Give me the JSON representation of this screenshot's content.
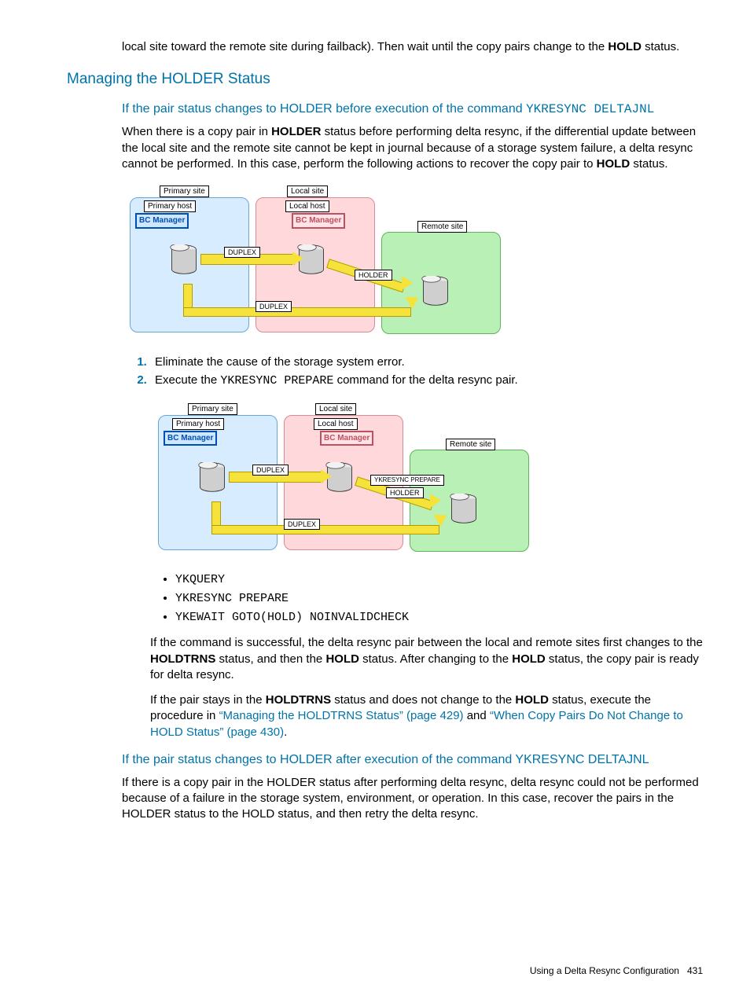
{
  "intro": {
    "p1a": "local site toward the remote site during failback). Then wait until the copy pairs change to the ",
    "p1b": "HOLD",
    "p1c": " status."
  },
  "h2": "Managing the HOLDER Status",
  "sec1": {
    "h3a": "If the pair status changes to HOLDER before execution of the command ",
    "h3b": "YKRESYNC DELTAJNL",
    "p1a": "When there is a copy pair in ",
    "p1b": "HOLDER",
    "p1c": " status before performing delta resync, if the differential update between the local site and the remote site cannot be kept in journal because of a storage system failure, a delta resync cannot be performed. In this case, perform the following actions to recover the copy pair to ",
    "p1d": "HOLD",
    "p1e": " status."
  },
  "diagram1": {
    "primary_site": "Primary site",
    "primary_host": "Primary host",
    "bc": "BC Manager",
    "local_site": "Local site",
    "local_host": "Local host",
    "remote_site": "Remote site",
    "duplex": "DUPLEX",
    "holder": "HOLDER"
  },
  "steps": {
    "s1": "Eliminate the cause of the storage system error.",
    "s2a": "Execute the ",
    "s2b": "YKRESYNC PREPARE",
    "s2c": " command for the delta resync pair."
  },
  "diagram2": {
    "ykresync_prepare": "YKRESYNC PREPARE"
  },
  "cmds": {
    "c1": "YKQUERY",
    "c2": "YKRESYNC PREPARE",
    "c3": "YKEWAIT GOTO(HOLD) NOINVALIDCHECK"
  },
  "after": {
    "p1a": "If the command is successful, the delta resync pair between the local and remote sites first changes to the ",
    "p1b": "HOLDTRNS",
    "p1c": " status, and then the ",
    "p1d": "HOLD",
    "p1e": " status. After changing to the ",
    "p1f": "HOLD",
    "p1g": " status, the copy pair is ready for delta resync.",
    "p2a": "If the pair stays in the ",
    "p2b": "HOLDTRNS",
    "p2c": " status and does not change to the ",
    "p2d": "HOLD",
    "p2e": " status, execute the procedure in ",
    "link1": "“Managing the HOLDTRNS Status” (page 429)",
    "p2f": " and ",
    "link2": "“When Copy Pairs Do Not Change to HOLD Status” (page 430)",
    "p2g": "."
  },
  "sec2": {
    "h3": "If the pair status changes to HOLDER after execution of the command YKRESYNC DELTAJNL",
    "p1": "If there is a copy pair in the HOLDER status after performing delta resync, delta resync could not be performed because of a failure in the storage system, environment, or operation. In this case, recover the pairs in the HOLDER status to the HOLD status, and then retry the delta resync."
  },
  "footer": {
    "text": "Using a Delta Resync Configuration",
    "page": "431"
  }
}
